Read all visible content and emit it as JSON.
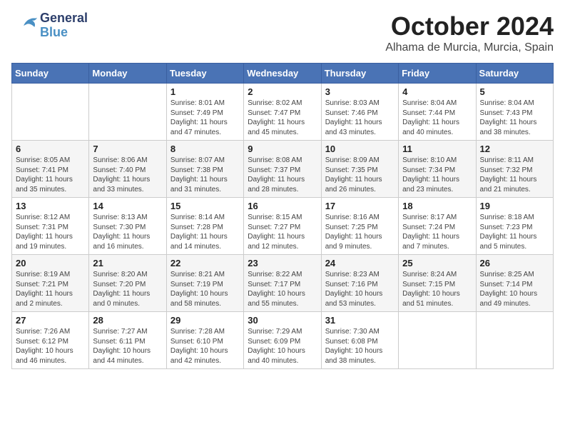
{
  "header": {
    "logo_general": "General",
    "logo_blue": "Blue",
    "month": "October 2024",
    "location": "Alhama de Murcia, Murcia, Spain"
  },
  "columns": [
    "Sunday",
    "Monday",
    "Tuesday",
    "Wednesday",
    "Thursday",
    "Friday",
    "Saturday"
  ],
  "weeks": [
    [
      {
        "day": "",
        "content": ""
      },
      {
        "day": "",
        "content": ""
      },
      {
        "day": "1",
        "content": "Sunrise: 8:01 AM\nSunset: 7:49 PM\nDaylight: 11 hours and 47 minutes."
      },
      {
        "day": "2",
        "content": "Sunrise: 8:02 AM\nSunset: 7:47 PM\nDaylight: 11 hours and 45 minutes."
      },
      {
        "day": "3",
        "content": "Sunrise: 8:03 AM\nSunset: 7:46 PM\nDaylight: 11 hours and 43 minutes."
      },
      {
        "day": "4",
        "content": "Sunrise: 8:04 AM\nSunset: 7:44 PM\nDaylight: 11 hours and 40 minutes."
      },
      {
        "day": "5",
        "content": "Sunrise: 8:04 AM\nSunset: 7:43 PM\nDaylight: 11 hours and 38 minutes."
      }
    ],
    [
      {
        "day": "6",
        "content": "Sunrise: 8:05 AM\nSunset: 7:41 PM\nDaylight: 11 hours and 35 minutes."
      },
      {
        "day": "7",
        "content": "Sunrise: 8:06 AM\nSunset: 7:40 PM\nDaylight: 11 hours and 33 minutes."
      },
      {
        "day": "8",
        "content": "Sunrise: 8:07 AM\nSunset: 7:38 PM\nDaylight: 11 hours and 31 minutes."
      },
      {
        "day": "9",
        "content": "Sunrise: 8:08 AM\nSunset: 7:37 PM\nDaylight: 11 hours and 28 minutes."
      },
      {
        "day": "10",
        "content": "Sunrise: 8:09 AM\nSunset: 7:35 PM\nDaylight: 11 hours and 26 minutes."
      },
      {
        "day": "11",
        "content": "Sunrise: 8:10 AM\nSunset: 7:34 PM\nDaylight: 11 hours and 23 minutes."
      },
      {
        "day": "12",
        "content": "Sunrise: 8:11 AM\nSunset: 7:32 PM\nDaylight: 11 hours and 21 minutes."
      }
    ],
    [
      {
        "day": "13",
        "content": "Sunrise: 8:12 AM\nSunset: 7:31 PM\nDaylight: 11 hours and 19 minutes."
      },
      {
        "day": "14",
        "content": "Sunrise: 8:13 AM\nSunset: 7:30 PM\nDaylight: 11 hours and 16 minutes."
      },
      {
        "day": "15",
        "content": "Sunrise: 8:14 AM\nSunset: 7:28 PM\nDaylight: 11 hours and 14 minutes."
      },
      {
        "day": "16",
        "content": "Sunrise: 8:15 AM\nSunset: 7:27 PM\nDaylight: 11 hours and 12 minutes."
      },
      {
        "day": "17",
        "content": "Sunrise: 8:16 AM\nSunset: 7:25 PM\nDaylight: 11 hours and 9 minutes."
      },
      {
        "day": "18",
        "content": "Sunrise: 8:17 AM\nSunset: 7:24 PM\nDaylight: 11 hours and 7 minutes."
      },
      {
        "day": "19",
        "content": "Sunrise: 8:18 AM\nSunset: 7:23 PM\nDaylight: 11 hours and 5 minutes."
      }
    ],
    [
      {
        "day": "20",
        "content": "Sunrise: 8:19 AM\nSunset: 7:21 PM\nDaylight: 11 hours and 2 minutes."
      },
      {
        "day": "21",
        "content": "Sunrise: 8:20 AM\nSunset: 7:20 PM\nDaylight: 11 hours and 0 minutes."
      },
      {
        "day": "22",
        "content": "Sunrise: 8:21 AM\nSunset: 7:19 PM\nDaylight: 10 hours and 58 minutes."
      },
      {
        "day": "23",
        "content": "Sunrise: 8:22 AM\nSunset: 7:17 PM\nDaylight: 10 hours and 55 minutes."
      },
      {
        "day": "24",
        "content": "Sunrise: 8:23 AM\nSunset: 7:16 PM\nDaylight: 10 hours and 53 minutes."
      },
      {
        "day": "25",
        "content": "Sunrise: 8:24 AM\nSunset: 7:15 PM\nDaylight: 10 hours and 51 minutes."
      },
      {
        "day": "26",
        "content": "Sunrise: 8:25 AM\nSunset: 7:14 PM\nDaylight: 10 hours and 49 minutes."
      }
    ],
    [
      {
        "day": "27",
        "content": "Sunrise: 7:26 AM\nSunset: 6:12 PM\nDaylight: 10 hours and 46 minutes."
      },
      {
        "day": "28",
        "content": "Sunrise: 7:27 AM\nSunset: 6:11 PM\nDaylight: 10 hours and 44 minutes."
      },
      {
        "day": "29",
        "content": "Sunrise: 7:28 AM\nSunset: 6:10 PM\nDaylight: 10 hours and 42 minutes."
      },
      {
        "day": "30",
        "content": "Sunrise: 7:29 AM\nSunset: 6:09 PM\nDaylight: 10 hours and 40 minutes."
      },
      {
        "day": "31",
        "content": "Sunrise: 7:30 AM\nSunset: 6:08 PM\nDaylight: 10 hours and 38 minutes."
      },
      {
        "day": "",
        "content": ""
      },
      {
        "day": "",
        "content": ""
      }
    ]
  ]
}
